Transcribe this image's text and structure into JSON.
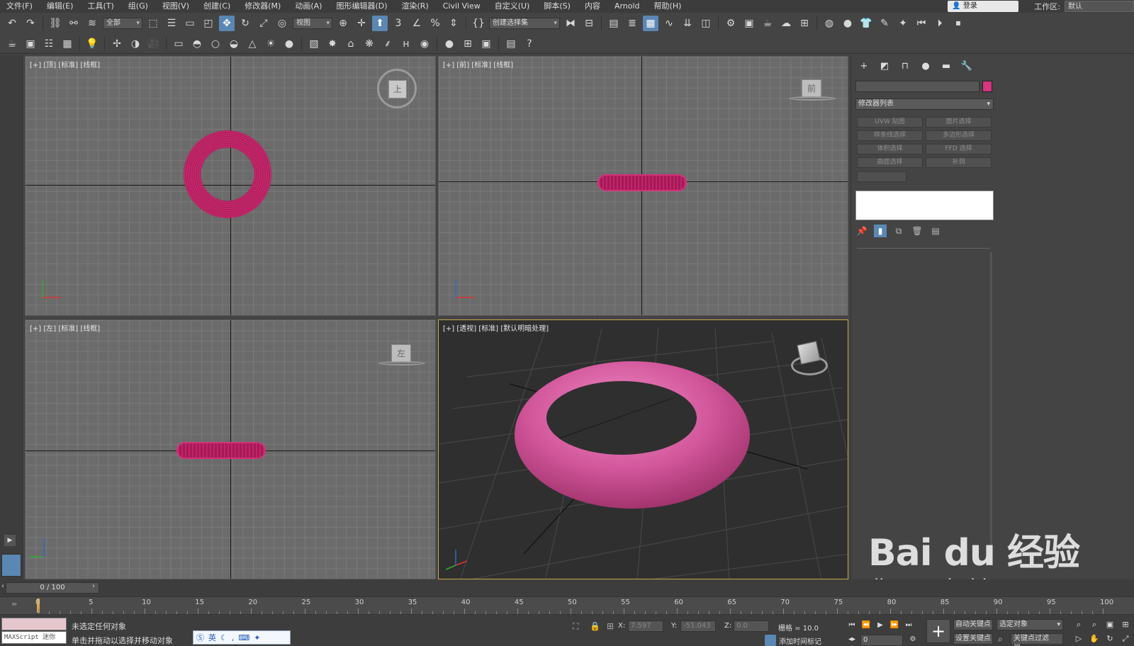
{
  "menu": [
    "文件(F)",
    "编辑(E)",
    "工具(T)",
    "组(G)",
    "视图(V)",
    "创建(C)",
    "修改器(M)",
    "动画(A)",
    "图形编辑器(D)",
    "渲染(R)",
    "Civil View",
    "自定义(U)",
    "脚本(S)",
    "内容",
    "Arnold",
    "帮助(H)"
  ],
  "login": "登录",
  "workspace_label": "工作区:",
  "workspace_value": "默认",
  "toolbar": {
    "filter_dropdown": "全部",
    "refcoord_dropdown": "视图",
    "selection_set_dropdown": "创建选择集"
  },
  "viewports": {
    "top": {
      "label": "[+] [顶] [标准] [线框]",
      "cube": "上"
    },
    "front": {
      "label": "[+] [前] [标准] [线框]",
      "cube": "前"
    },
    "left": {
      "label": "[+] [左] [标准] [线框]",
      "cube": "左"
    },
    "persp": {
      "label": "[+] [透视] [标准] [默认明暗处理]"
    }
  },
  "object_color": "#d6357f",
  "command_panel": {
    "modifier_list": "修改器列表",
    "modifier_buttons": [
      "UVW 贴图",
      "面片选择",
      "样条线选择",
      "多边形选择",
      "体积选择",
      "FFD 选择",
      "曲面选择",
      "补洞"
    ]
  },
  "timeline": {
    "frame_display": "0 / 100",
    "ticks": [
      "0",
      "5",
      "10",
      "15",
      "20",
      "25",
      "30",
      "35",
      "40",
      "45",
      "50",
      "55",
      "60",
      "65",
      "70",
      "75",
      "80",
      "85",
      "90",
      "95",
      "100"
    ]
  },
  "status": {
    "maxscript": "MAXScript 迷你",
    "line1": "未选定任何对象",
    "line2": "单击并拖动以选择并移动对象",
    "ime_text": "英",
    "x_label": "X:",
    "x_value": "7.597",
    "y_label": "Y:",
    "y_value": "-51.043",
    "z_label": "Z:",
    "z_value": "0.0",
    "grid": "栅格 = 10.0",
    "add_time_tag": "添加时间标记",
    "frame_field": "0",
    "auto_key": "自动关键点",
    "set_key": "设置关键点",
    "selected_object": "选定对象",
    "key_filter": "关键点过滤器..."
  },
  "watermark": {
    "main": "Bai du 经验",
    "sub": "jingyan.baidu.com"
  }
}
